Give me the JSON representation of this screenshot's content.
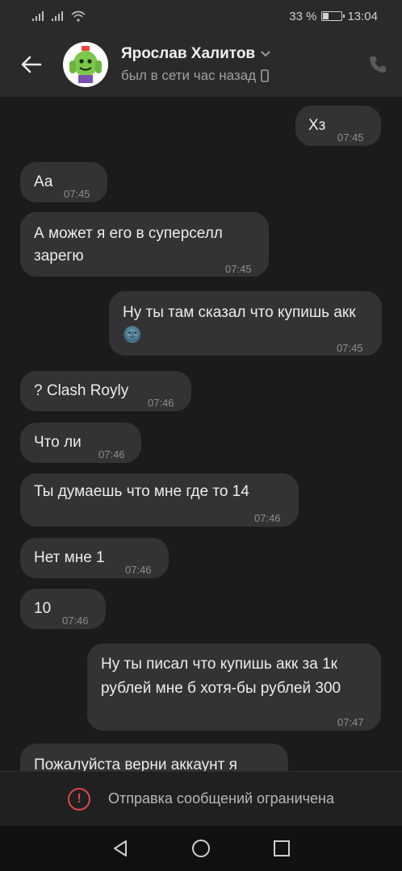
{
  "status_bar": {
    "battery": "33 %",
    "battery_level": 0.33,
    "time": "13:04"
  },
  "header": {
    "name": "Ярослав Халитов",
    "status": "был в сети час назад"
  },
  "messages": [
    {
      "side": "out",
      "text": "Хз",
      "time": "07:45"
    },
    {
      "side": "in",
      "text": "Аа",
      "time": "07:45"
    },
    {
      "side": "in",
      "text": "А может я его в суперселл зарегю",
      "time": "07:45"
    },
    {
      "side": "out",
      "text": "Ну ты там сказал что купишь акк 🌚",
      "time": "07:45"
    },
    {
      "side": "in",
      "text": "? Clash Royly",
      "time": "07:46"
    },
    {
      "side": "in",
      "text": "Что ли",
      "time": "07:46"
    },
    {
      "side": "in",
      "text": "Ты думаешь что мне где то 14",
      "time": "07:46"
    },
    {
      "side": "in",
      "text": "Нет мне 1",
      "time": "07:46"
    },
    {
      "side": "in",
      "text": "10",
      "time": "07:46"
    },
    {
      "side": "out",
      "text": "Ну ты писал что купишь акк за 1к рублей мне б хотя-бы рублей 300",
      "time": "07:47"
    },
    {
      "side": "in",
      "text": "Пожалуйста верни аккаунт я",
      "time": ""
    }
  ],
  "restricted_notice": "Отправка сообщений ограничена",
  "colors": {
    "background": "#1b1b1c",
    "bubble": "#333335",
    "header": "#2a2a2b",
    "warning": "#e04848"
  }
}
